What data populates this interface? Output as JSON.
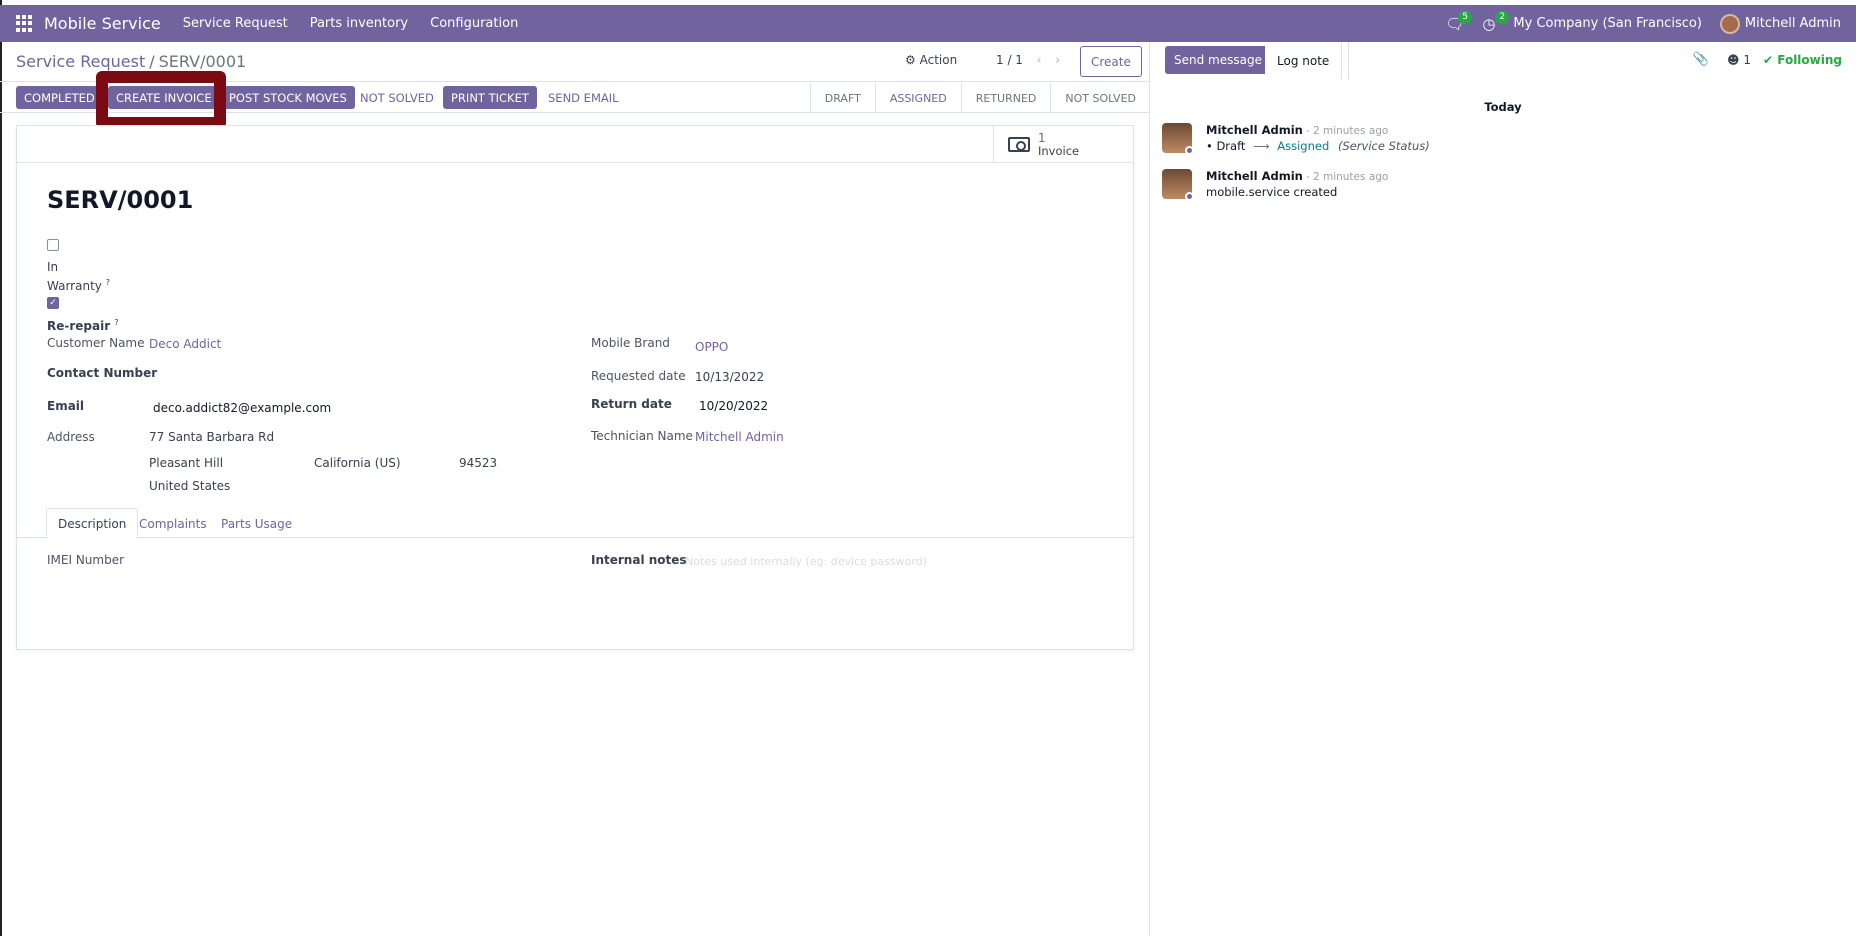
{
  "navbar": {
    "brand": "Mobile Service",
    "menus": [
      "Service Request",
      "Parts inventory",
      "Configuration"
    ],
    "messages_count": "5",
    "activities_count": "2",
    "company": "My Company (San Francisco)",
    "user": "Mitchell Admin"
  },
  "control": {
    "breadcrumb_parent": "Service Request",
    "breadcrumb_current": "SERV/0001",
    "action_label": "Action",
    "pager": "1 / 1",
    "create_label": "Create"
  },
  "statusbar": {
    "buttons": [
      "COMPLETED",
      "CREATE INVOICE",
      "POST STOCK MOVES",
      "NOT SOLVED",
      "PRINT TICKET",
      "SEND EMAIL"
    ],
    "stages": [
      "DRAFT",
      "ASSIGNED",
      "RETURNED",
      "NOT SOLVED"
    ],
    "active_stage": "ASSIGNED"
  },
  "smart_button": {
    "count": "1",
    "label": "Invoice"
  },
  "form": {
    "title": "SERV/0001",
    "in_warranty_label_1": "In",
    "in_warranty_label_2": "Warranty",
    "re_repair_label": "Re-repair",
    "help_mark": "?",
    "customer_label": "Customer Name",
    "customer_value": "Deco Addict",
    "contact_label": "Contact Number",
    "email_label": "Email",
    "email_value": "deco.addict82@example.com",
    "address_label": "Address",
    "street": "77 Santa Barbara Rd",
    "city": "Pleasant Hill",
    "state": "California (US)",
    "zip": "94523",
    "country": "United States",
    "brand_label": "Mobile Brand",
    "brand_value": "OPPO",
    "requested_label": "Requested date",
    "requested_value": "10/13/2022",
    "return_label": "Return date",
    "return_value": "10/20/2022",
    "technician_label": "Technician Name",
    "technician_value": "Mitchell Admin"
  },
  "tabs": {
    "items": [
      "Description",
      "Complaints",
      "Parts Usage"
    ],
    "imei_label": "IMEI Number",
    "notes_label": "Internal notes",
    "notes_placeholder": "Notes used internally (eg: device password)"
  },
  "chatter": {
    "send_label": "Send message",
    "log_label": "Log note",
    "followers_count": "1",
    "following_label": "Following",
    "day_label": "Today",
    "messages": [
      {
        "author": "Mitchell Admin",
        "time": "- 2 minutes ago",
        "old_value": "Draft",
        "new_value": "Assigned",
        "field": "(Service Status)"
      },
      {
        "author": "Mitchell Admin",
        "time": "- 2 minutes ago",
        "body": "mobile.service created"
      }
    ]
  },
  "colors": {
    "brand": "#71639e",
    "highlight": "#7a0b12",
    "success": "#28a745"
  }
}
